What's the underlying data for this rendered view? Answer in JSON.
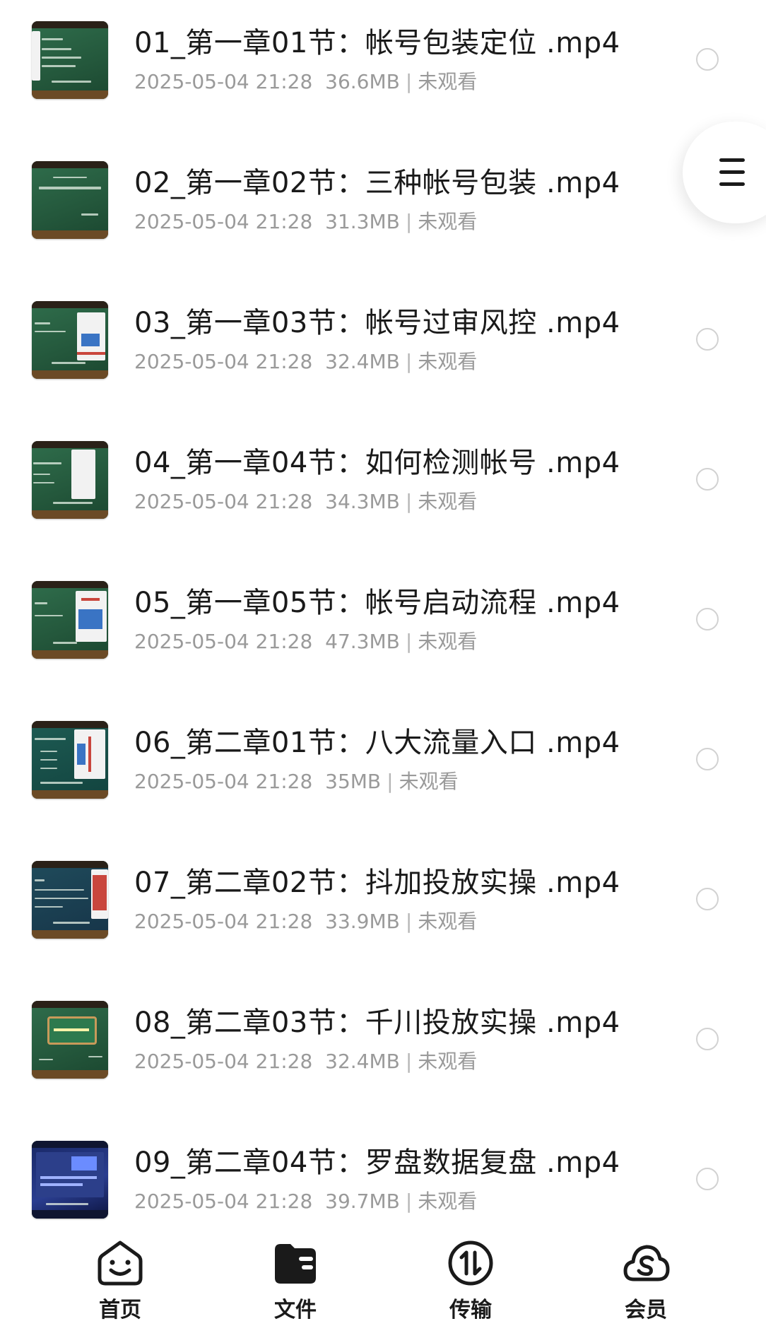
{
  "files": [
    {
      "title": "01_第一章01节：帐号包装定位 .mp4",
      "date": "2025-05-04 21:28",
      "size": "36.6MB",
      "status": "未观看"
    },
    {
      "title": "02_第一章02节：三种帐号包装 .mp4",
      "date": "2025-05-04 21:28",
      "size": "31.3MB",
      "status": "未观看"
    },
    {
      "title": "03_第一章03节：帐号过审风控 .mp4",
      "date": "2025-05-04 21:28",
      "size": "32.4MB",
      "status": "未观看"
    },
    {
      "title": "04_第一章04节：如何检测帐号 .mp4",
      "date": "2025-05-04 21:28",
      "size": "34.3MB",
      "status": "未观看"
    },
    {
      "title": "05_第一章05节：帐号启动流程 .mp4",
      "date": "2025-05-04 21:28",
      "size": "47.3MB",
      "status": "未观看"
    },
    {
      "title": "06_第二章01节：八大流量入口 .mp4",
      "date": "2025-05-04 21:28",
      "size": "35MB",
      "status": "未观看"
    },
    {
      "title": "07_第二章02节：抖加投放实操 .mp4",
      "date": "2025-05-04 21:28",
      "size": "33.9MB",
      "status": "未观看"
    },
    {
      "title": "08_第二章03节：千川投放实操 .mp4",
      "date": "2025-05-04 21:28",
      "size": "32.4MB",
      "status": "未观看"
    },
    {
      "title": "09_第二章04节：罗盘数据复盘 .mp4",
      "date": "2025-05-04 21:28",
      "size": "39.7MB",
      "status": "未观看"
    }
  ],
  "meta_separator": "|",
  "side_menu": {
    "icon": "menu-icon"
  },
  "tabbar": {
    "tabs": [
      {
        "label": "首页",
        "icon": "home-face-icon"
      },
      {
        "label": "文件",
        "icon": "folder-icon",
        "active": true
      },
      {
        "label": "传输",
        "icon": "transfer-icon"
      },
      {
        "label": "会员",
        "icon": "vip-cloud-icon"
      }
    ]
  },
  "colors": {
    "title_text": "#1a1a1a",
    "meta_text": "#9a9a9a",
    "radio_border": "#d2d2d2",
    "background": "#ffffff"
  }
}
